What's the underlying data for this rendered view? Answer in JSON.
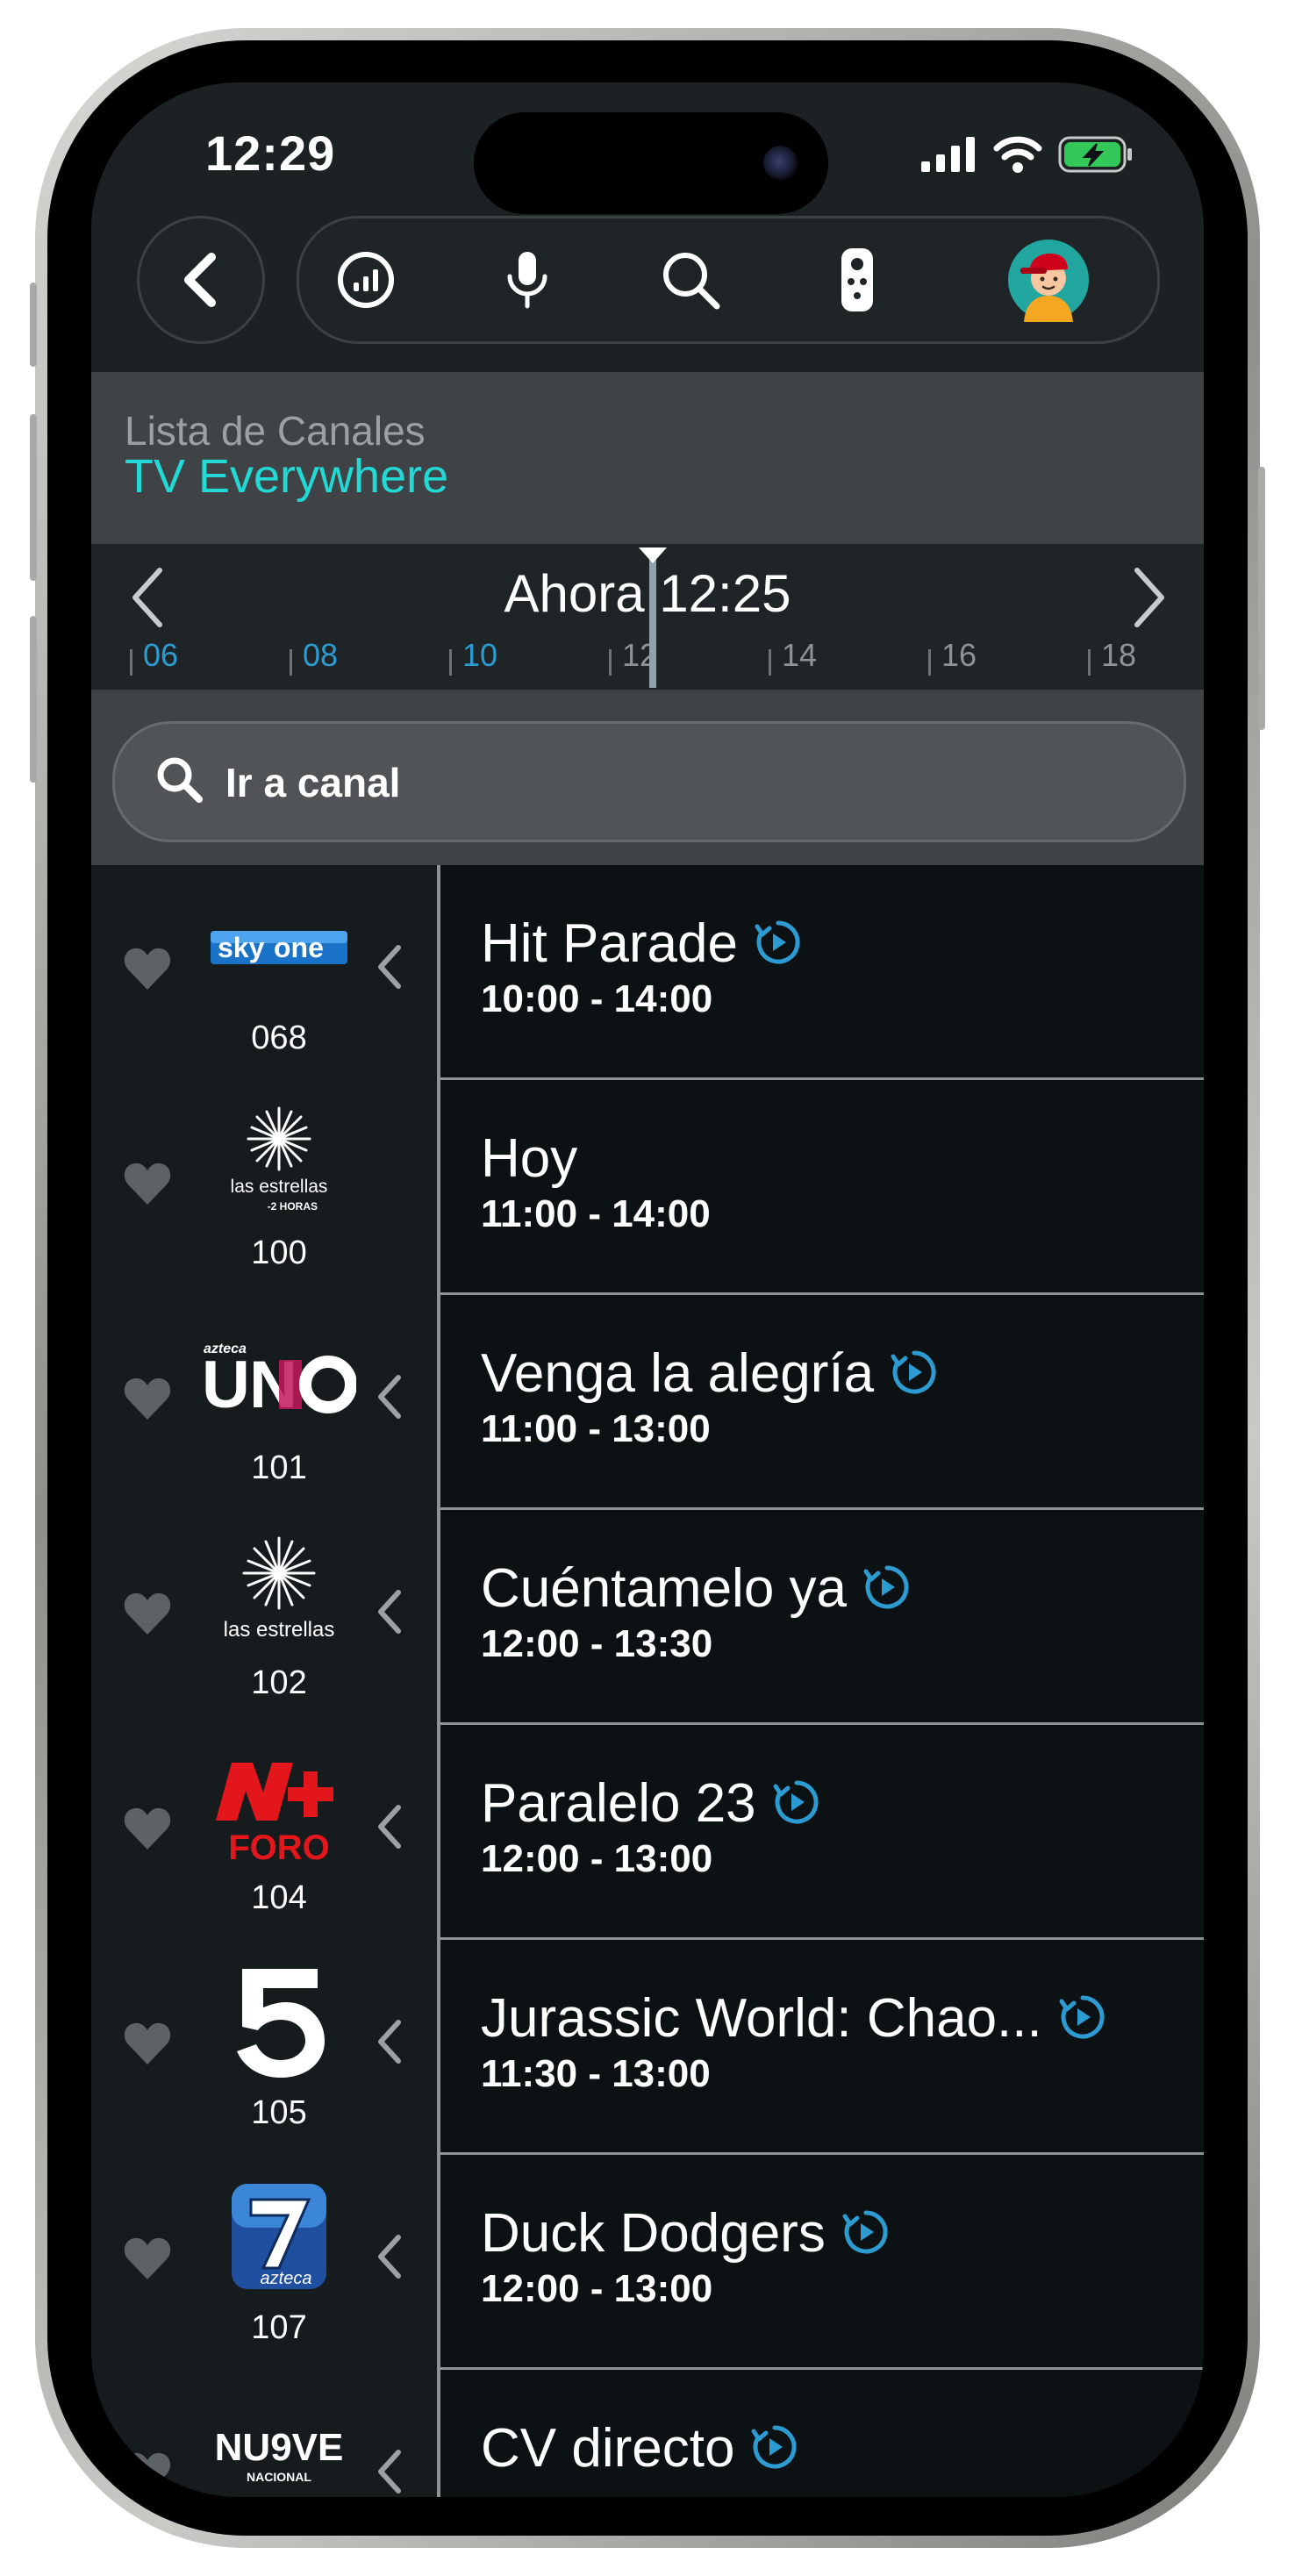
{
  "status": {
    "time": "12:29"
  },
  "header": {
    "subtitle": "Lista de Canales",
    "title": "TV Everywhere"
  },
  "timeline": {
    "now_label": "Ahora 12:25",
    "ticks": [
      "06",
      "08",
      "10",
      "12",
      "14",
      "16",
      "18"
    ]
  },
  "search": {
    "placeholder": "Ir a canal"
  },
  "colors": {
    "accent": "#22d9d6",
    "tick_past": "#2c9bd1",
    "tick_future": "#8e9496",
    "replay": "#2c9bd1"
  },
  "channels": [
    {
      "logo": "sky one",
      "number": "068",
      "program": "Hit Parade",
      "time": "10:00 - 14:00",
      "replay": true
    },
    {
      "logo": "las estrellas -2 HORAS",
      "number": "100",
      "program": "Hoy",
      "time": "11:00 - 14:00",
      "replay": false
    },
    {
      "logo": "azteca UNO",
      "number": "101",
      "program": "Venga la alegría",
      "time": "11:00 - 13:00",
      "replay": true
    },
    {
      "logo": "las estrellas",
      "number": "102",
      "program": "Cuéntamelo ya",
      "time": "12:00 - 13:30",
      "replay": true
    },
    {
      "logo": "N+ FORO",
      "number": "104",
      "program": "Paralelo 23",
      "time": "12:00 - 13:00",
      "replay": true
    },
    {
      "logo": "5",
      "number": "105",
      "program": "Jurassic World: Chao...",
      "time": "11:30 - 13:00",
      "replay": true
    },
    {
      "logo": "7 azteca",
      "number": "107",
      "program": "Duck Dodgers",
      "time": "12:00 - 13:00",
      "replay": true
    },
    {
      "logo": "NUEVE NACIONAL",
      "number": "",
      "program": "CV directo",
      "time": "",
      "replay": true
    }
  ]
}
